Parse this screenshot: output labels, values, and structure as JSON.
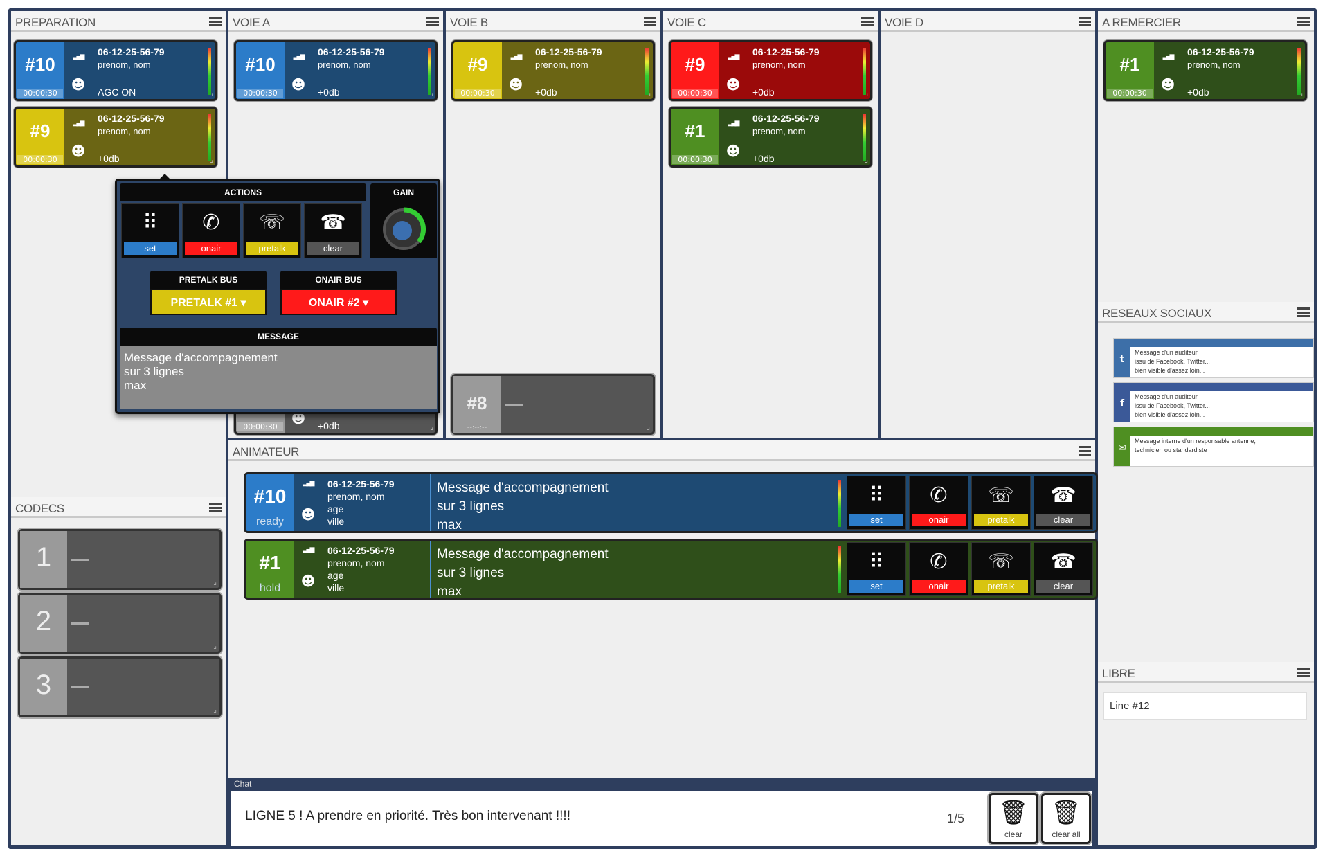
{
  "columns": {
    "preparation": "PREPARATION",
    "voie_a": "VOIE A",
    "voie_b": "VOIE B",
    "voie_c": "VOIE C",
    "voie_d": "VOIE D",
    "a_remercier": "A REMERCIER",
    "reseaux": "RESEAUX SOCIAUX",
    "libre": "LIBRE",
    "codecs": "CODECS",
    "animateur": "ANIMATEUR",
    "chat": "Chat"
  },
  "calls": [
    {
      "num": "#10",
      "phone": "06-12-25-56-79",
      "name": "prenom, nom",
      "extra": "AGC ON",
      "time": "00:00:30",
      "color": "blue"
    },
    {
      "num": "#9",
      "phone": "06-12-25-56-79",
      "name": "prenom, nom",
      "extra": "+0db",
      "time": "00:00:30",
      "color": "yellow"
    },
    {
      "num": "#10",
      "phone": "06-12-25-56-79",
      "name": "prenom, nom",
      "extra": "+0db",
      "time": "00:00:30",
      "color": "blue"
    },
    {
      "num": "#9",
      "phone": "06-12-25-56-79",
      "name": "prenom, nom",
      "extra": "+0db",
      "time": "00:00:30",
      "color": "yellow"
    },
    {
      "num": "#9",
      "phone": "06-12-25-56-79",
      "name": "prenom, nom",
      "extra": "+0db",
      "time": "00:00:30",
      "color": "red"
    },
    {
      "num": "#1",
      "phone": "06-12-25-56-79",
      "name": "prenom, nom",
      "extra": "+0db",
      "time": "00:00:30",
      "color": "green"
    },
    {
      "num": "#1",
      "phone": "06-12-25-56-79",
      "name": "prenom, nom",
      "extra": "+0db",
      "time": "00:00:30",
      "color": "green"
    }
  ],
  "hidden_card": {
    "time": "00:00:30",
    "extra": "+0db"
  },
  "voie_b_slot": {
    "num": "#8",
    "time": "--:--:--"
  },
  "popup": {
    "actions_title": "ACTIONS",
    "gain_title": "GAIN",
    "buttons": [
      "set",
      "onair",
      "pretalk",
      "clear"
    ],
    "pretalk_bus_title": "PRETALK BUS",
    "pretalk_bus_value": "PRETALK #1",
    "onair_bus_title": "ONAIR BUS",
    "onair_bus_value": "ONAIR #2",
    "message_title": "MESSAGE",
    "message_lines": [
      "Message d'accompagnement",
      "sur 3 lignes",
      "max"
    ]
  },
  "codecs": [
    "1",
    "2",
    "3"
  ],
  "animateur": [
    {
      "num": "#10",
      "state": "ready",
      "phone": "06-12-25-56-79",
      "name": "prenom, nom",
      "age": "age",
      "ville": "ville",
      "msg1": "Message d'accompagnement",
      "msg2": "sur 3 lignes",
      "msg3": "max",
      "color": "blue"
    },
    {
      "num": "#1",
      "state": "hold",
      "phone": "06-12-25-56-79",
      "name": "prenom, nom",
      "age": "age",
      "ville": "ville",
      "msg1": "Message d'accompagnement",
      "msg2": "sur 3 lignes",
      "msg3": "max",
      "color": "green"
    }
  ],
  "anim_buttons": [
    "set",
    "onair",
    "pretalk",
    "clear"
  ],
  "social": [
    {
      "network": "twitter",
      "icon": "t",
      "color": "#3d6fa8",
      "lines": [
        "Message d'un auditeur",
        "issu de Facebook, Twitter...",
        "bien visible d'assez loin..."
      ]
    },
    {
      "network": "facebook",
      "icon": "f",
      "color": "#3b5998",
      "lines": [
        "Message d'un auditeur",
        "issu de Facebook, Twitter...",
        "bien visible d'assez loin..."
      ]
    },
    {
      "network": "internal",
      "icon": "✉",
      "color": "#4f8f22",
      "lines": [
        "Message interne d'un responsable antenne,",
        "technicien ou standardiste"
      ]
    }
  ],
  "libre": {
    "value": "Line #12"
  },
  "chat": {
    "message": "LIGNE 5 ! A prendre en priorité. Très bon intervenant !!!!",
    "page": "1/5",
    "clear": "clear",
    "clear_all": "clear all"
  }
}
